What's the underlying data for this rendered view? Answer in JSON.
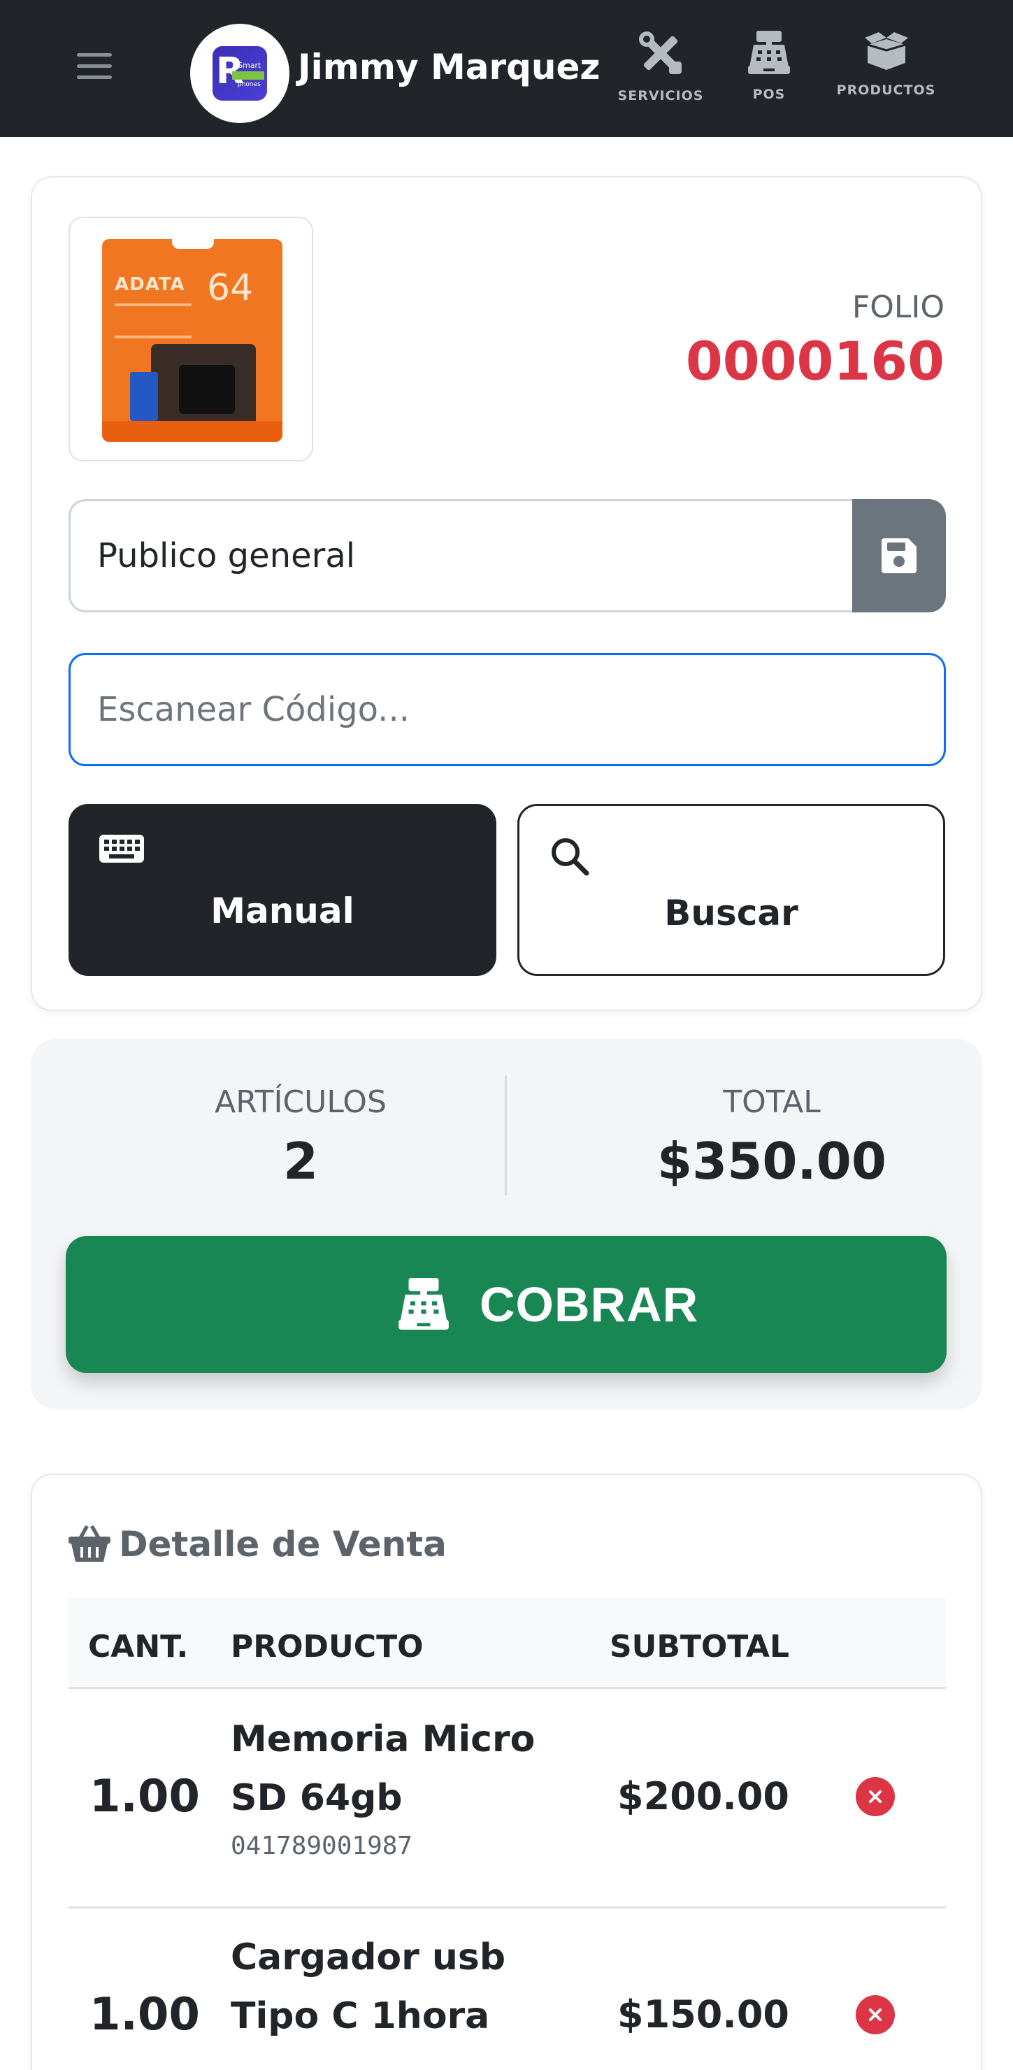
{
  "header": {
    "brand_name": "Jimmy Marquez",
    "logo_letter": "R",
    "logo_text_top": "Smart",
    "logo_text_bottom": "phones",
    "nav": [
      {
        "label": "SERVICIOS",
        "icon": "tools-icon"
      },
      {
        "label": "POS",
        "icon": "cash-register-icon"
      },
      {
        "label": "PRODUCTOS",
        "icon": "box-open-icon"
      }
    ]
  },
  "sale": {
    "folio_label": "FOLIO",
    "folio_value": "0000160",
    "product_image_text": {
      "brand": "ADATA",
      "capacity": "64"
    },
    "client_value": "Publico general",
    "scan_placeholder": "Escanear Código...",
    "manual_label": "Manual",
    "search_label": "Buscar"
  },
  "totals": {
    "items_label": "ARTÍCULOS",
    "items_value": "2",
    "total_label": "TOTAL",
    "total_value": "$350.00",
    "charge_label": "COBRAR"
  },
  "detail": {
    "title": "Detalle de Venta",
    "columns": {
      "qty": "CANT.",
      "product": "PRODUCTO",
      "subtotal": "SUBTOTAL"
    },
    "rows": [
      {
        "qty": "1.00",
        "name": "Memoria Micro SD 64gb",
        "code": "041789001987",
        "subtotal": "$200.00"
      },
      {
        "qty": "1.00",
        "name": "Cargador usb Tipo C 1hora",
        "code": "",
        "subtotal": "$150.00"
      }
    ]
  },
  "colors": {
    "navbar": "#212529",
    "folio": "#dc3545",
    "charge": "#198754",
    "focus_border": "#0d6efd",
    "save_button": "#6c757d"
  }
}
